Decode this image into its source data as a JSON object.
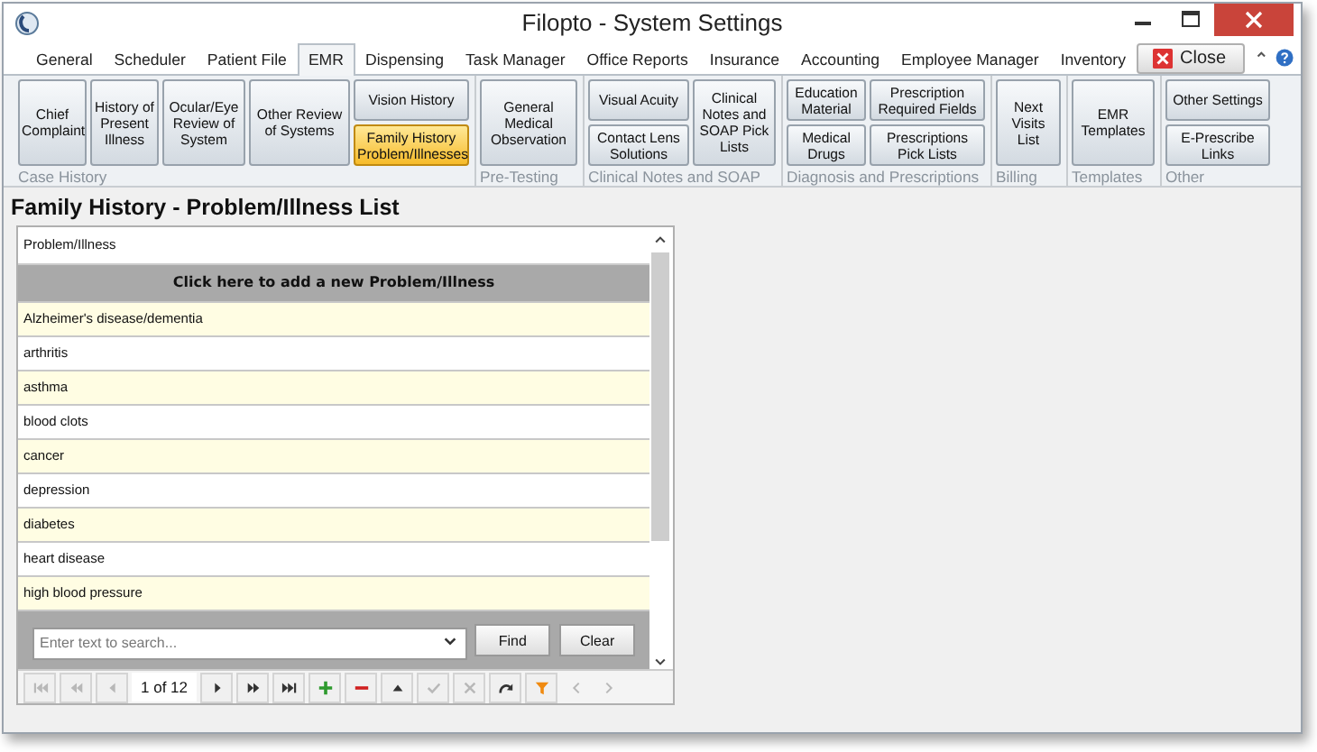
{
  "window": {
    "title": "Filopto - System Settings"
  },
  "tabs": [
    {
      "label": "General",
      "selected": false
    },
    {
      "label": "Scheduler",
      "selected": false
    },
    {
      "label": "Patient File",
      "selected": false
    },
    {
      "label": "EMR",
      "selected": true
    },
    {
      "label": "Dispensing",
      "selected": false
    },
    {
      "label": "Task Manager",
      "selected": false
    },
    {
      "label": "Office Reports",
      "selected": false
    },
    {
      "label": "Insurance",
      "selected": false
    },
    {
      "label": "Accounting",
      "selected": false
    },
    {
      "label": "Employee Manager",
      "selected": false
    },
    {
      "label": "Inventory",
      "selected": false
    }
  ],
  "close_button": "Close",
  "ribbon": [
    {
      "label": "Case History",
      "columns": [
        [
          {
            "label": "Chief Complaint",
            "selected": false
          }
        ],
        [
          {
            "label": "History of Present Illness",
            "selected": false
          }
        ],
        [
          {
            "label": "Ocular/Eye Review of System",
            "selected": false
          }
        ],
        [
          {
            "label": "Other Review of Systems",
            "selected": false
          }
        ],
        [
          {
            "label": "Vision History",
            "selected": false
          },
          {
            "label": "Family History Problem/Illnesses",
            "selected": true
          }
        ]
      ]
    },
    {
      "label": "Pre-Testing",
      "columns": [
        [
          {
            "label": "General Medical Observation",
            "selected": false
          }
        ]
      ]
    },
    {
      "label": "Clinical Notes and SOAP",
      "columns": [
        [
          {
            "label": "Visual Acuity",
            "selected": false
          },
          {
            "label": "Contact Lens Solutions",
            "selected": false
          }
        ],
        [
          {
            "label": "Clinical Notes and SOAP Pick Lists",
            "selected": false
          }
        ]
      ]
    },
    {
      "label": "Diagnosis and Prescriptions",
      "columns": [
        [
          {
            "label": "Education Material",
            "selected": false
          },
          {
            "label": "Medical Drugs",
            "selected": false
          }
        ],
        [
          {
            "label": "Prescription Required Fields",
            "selected": false
          },
          {
            "label": "Prescriptions Pick Lists",
            "selected": false
          }
        ]
      ]
    },
    {
      "label": "Billing",
      "columns": [
        [
          {
            "label": "Next Visits List",
            "selected": false
          }
        ]
      ]
    },
    {
      "label": "Templates",
      "columns": [
        [
          {
            "label": "EMR Templates",
            "selected": false
          }
        ]
      ]
    },
    {
      "label": "Other",
      "columns": [
        [
          {
            "label": "Other Settings",
            "selected": false
          },
          {
            "label": "E-Prescribe Links",
            "selected": false
          }
        ]
      ]
    }
  ],
  "heading": "Family History - Problem/Illness List",
  "grid": {
    "column": "Problem/Illness",
    "add_row": "Click here to add a new Problem/Illness",
    "rows": [
      "Alzheimer's disease/dementia",
      "arthritis",
      "asthma",
      "blood clots",
      "cancer",
      "depression",
      "diabetes",
      "heart disease",
      "high blood pressure"
    ]
  },
  "search": {
    "placeholder": "Enter text to search...",
    "find": "Find",
    "clear": "Clear"
  },
  "navigator": {
    "page": "1 of 12",
    "buttons": [
      {
        "kind": "first",
        "disabled": true
      },
      {
        "kind": "prev-page",
        "disabled": true
      },
      {
        "kind": "prev",
        "disabled": true
      },
      {
        "kind": "page"
      },
      {
        "kind": "next",
        "disabled": false
      },
      {
        "kind": "next-page",
        "disabled": false
      },
      {
        "kind": "last",
        "disabled": false
      },
      {
        "kind": "add",
        "disabled": false
      },
      {
        "kind": "remove",
        "disabled": false
      },
      {
        "kind": "up",
        "disabled": false
      },
      {
        "kind": "check",
        "disabled": true
      },
      {
        "kind": "cancel",
        "disabled": true
      },
      {
        "kind": "refresh",
        "disabled": false
      },
      {
        "kind": "filter",
        "disabled": false
      },
      {
        "kind": "scroll-left",
        "disabled": true
      },
      {
        "kind": "scroll-right",
        "disabled": true
      }
    ]
  }
}
